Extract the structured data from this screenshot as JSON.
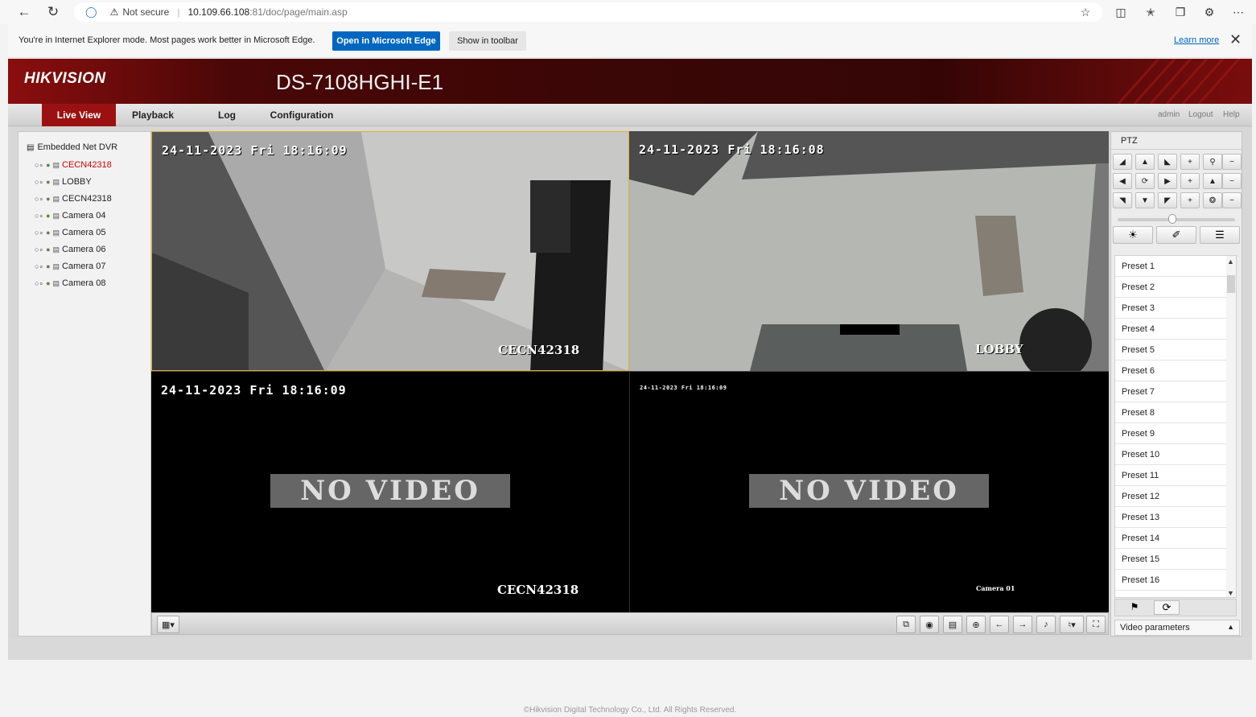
{
  "browser": {
    "not_secure": "Not secure",
    "url_host": "10.109.66.108",
    "url_rest": ":81/doc/page/main.asp",
    "ie_message": "You're in Internet Explorer mode. Most pages work better in Microsoft Edge.",
    "open_edge": "Open in Microsoft Edge",
    "show_toolbar": "Show in toolbar",
    "learn_more": "Learn more"
  },
  "header": {
    "logo": "HIKVISION",
    "model": "DS-7108HGHI-E1"
  },
  "tabs": [
    {
      "label": "Live View",
      "active": true
    },
    {
      "label": "Playback",
      "active": false
    },
    {
      "label": "Log",
      "active": false
    },
    {
      "label": "Configuration",
      "active": false
    }
  ],
  "user": {
    "admin": "admin",
    "logout": "Logout",
    "help": "Help"
  },
  "tree": {
    "root": "Embedded Net DVR",
    "cameras": [
      "CECN42318",
      "LOBBY",
      "CECN42318",
      "Camera 04",
      "Camera 05",
      "Camera 06",
      "Camera 07",
      "Camera 08"
    ]
  },
  "panes": [
    {
      "osd": "24-11-2023 Fri 18:16:09",
      "name": "CECN42318"
    },
    {
      "osd": "24-11-2023 Fri 18:16:08",
      "name": "LOBBY"
    },
    {
      "osd": "24-11-2023 Fri 18:16:09",
      "name": "CECN42318",
      "no_video": "NO VIDEO"
    },
    {
      "osd": "24-11-2023 Fri 18:16:09",
      "name": "Camera 01",
      "no_video": "NO VIDEO"
    }
  ],
  "ptz": {
    "title": "PTZ",
    "presets": [
      "Preset 1",
      "Preset 2",
      "Preset 3",
      "Preset 4",
      "Preset 5",
      "Preset 6",
      "Preset 7",
      "Preset 8",
      "Preset 9",
      "Preset 10",
      "Preset 11",
      "Preset 12",
      "Preset 13",
      "Preset 14",
      "Preset 15",
      "Preset 16"
    ],
    "video_params": "Video parameters"
  },
  "footer": "©Hikvision Digital Technology Co., Ltd. All Rights Reserved."
}
